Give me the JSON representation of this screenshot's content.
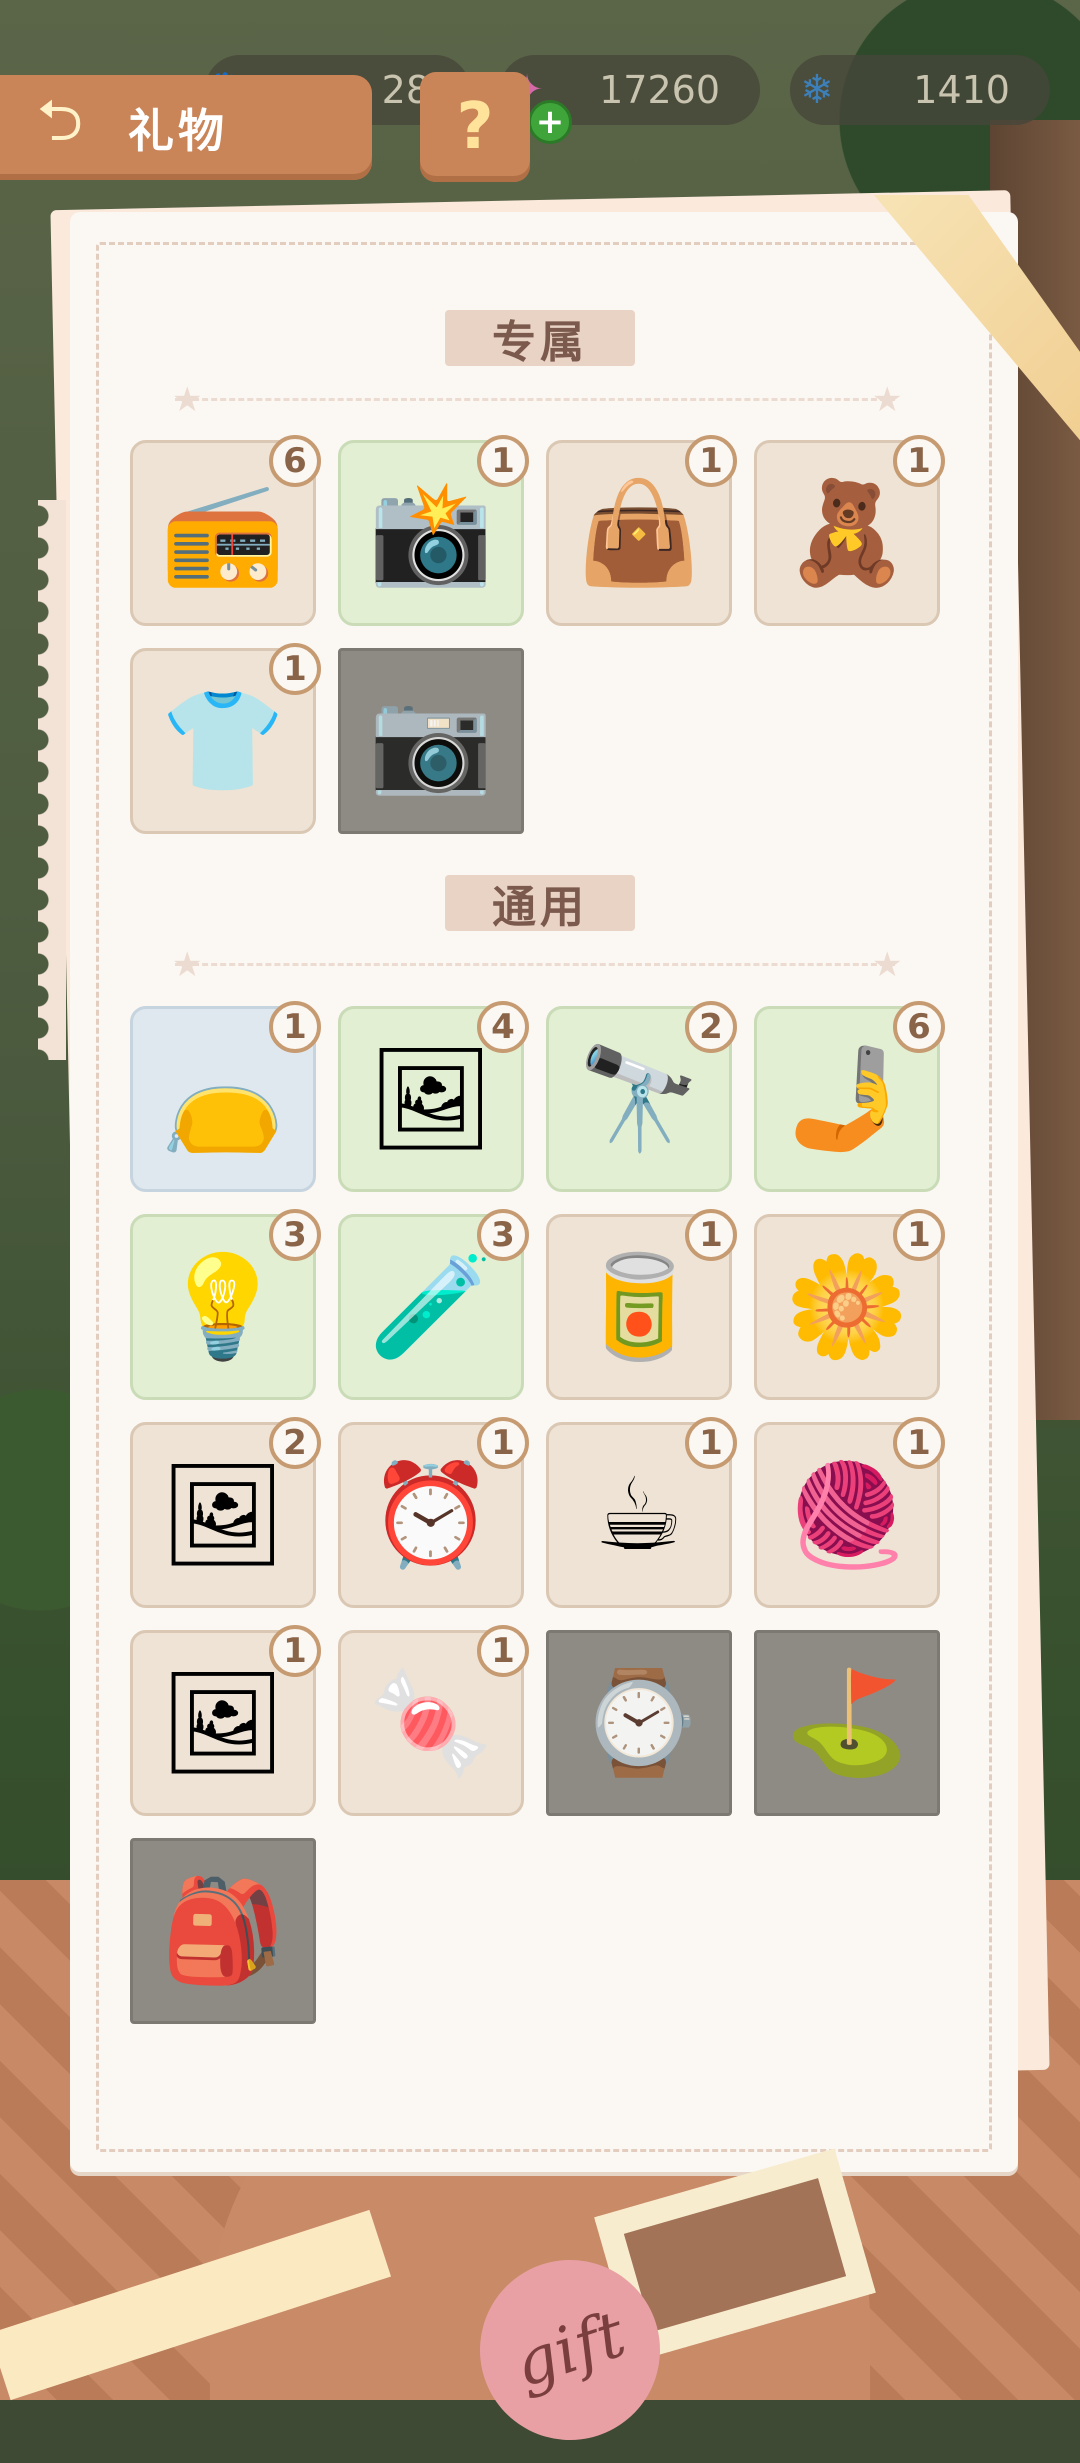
{
  "header": {
    "title": "礼物",
    "back_icon": "back-arrow-icon",
    "help_label": "?"
  },
  "currencies": [
    {
      "icon": "paw-icon",
      "value": "28"
    },
    {
      "icon": "star-icon",
      "value": "17260"
    },
    {
      "icon": "snowflake-icon",
      "value": "1410"
    }
  ],
  "sections": {
    "exclusive": {
      "title": "专属",
      "items": [
        {
          "name": "record-player",
          "icon": "📻",
          "count": "6",
          "bg": "beige"
        },
        {
          "name": "instant-camera",
          "icon": "📸",
          "count": "1",
          "bg": "green"
        },
        {
          "name": "tree-tote-bag",
          "icon": "👜",
          "count": "1",
          "bg": "beige"
        },
        {
          "name": "rainbow-pillow",
          "icon": "🧸",
          "count": "1",
          "bg": "beige"
        },
        {
          "name": "cat-tshirt",
          "icon": "👕",
          "count": "1",
          "bg": "beige"
        },
        {
          "name": "vintage-camera",
          "icon": "📷",
          "count": "",
          "bg": "gray"
        }
      ]
    },
    "general": {
      "title": "通用",
      "items": [
        {
          "name": "leather-pouch",
          "icon": "👝",
          "count": "1",
          "bg": "blue"
        },
        {
          "name": "easel",
          "icon": "🖼",
          "count": "4",
          "bg": "green"
        },
        {
          "name": "telescope",
          "icon": "🔭",
          "count": "2",
          "bg": "green"
        },
        {
          "name": "selfie-stick",
          "icon": "🤳",
          "count": "6",
          "bg": "green"
        },
        {
          "name": "desk-lamp",
          "icon": "💡",
          "count": "3",
          "bg": "green"
        },
        {
          "name": "potion-bottle",
          "icon": "🧪",
          "count": "3",
          "bg": "green"
        },
        {
          "name": "bear-tin",
          "icon": "🥫",
          "count": "1",
          "bg": "beige"
        },
        {
          "name": "flower-coaster",
          "icon": "🌼",
          "count": "1",
          "bg": "beige"
        },
        {
          "name": "landscape-painting",
          "icon": "🖼",
          "count": "2",
          "bg": "beige"
        },
        {
          "name": "digital-clock",
          "icon": "⏰",
          "count": "1",
          "bg": "beige"
        },
        {
          "name": "heart-mug",
          "icon": "☕",
          "count": "1",
          "bg": "beige"
        },
        {
          "name": "yarn-kettlebell",
          "icon": "🧶",
          "count": "1",
          "bg": "beige"
        },
        {
          "name": "photo-frame",
          "icon": "🖼",
          "count": "1",
          "bg": "beige"
        },
        {
          "name": "candy-box",
          "icon": "🍬",
          "count": "1",
          "bg": "beige"
        },
        {
          "name": "wristwatch",
          "icon": "⌚",
          "count": "",
          "bg": "gray"
        },
        {
          "name": "golf-bag",
          "icon": "⛳",
          "count": "",
          "bg": "gray"
        },
        {
          "name": "backpack",
          "icon": "🎒",
          "count": "",
          "bg": "gray"
        }
      ]
    }
  },
  "footer": {
    "gift_tag": "gift"
  },
  "colors": {
    "accent": "#c98458",
    "badge_border": "#c79b72",
    "panel": "#fbf7f2"
  }
}
